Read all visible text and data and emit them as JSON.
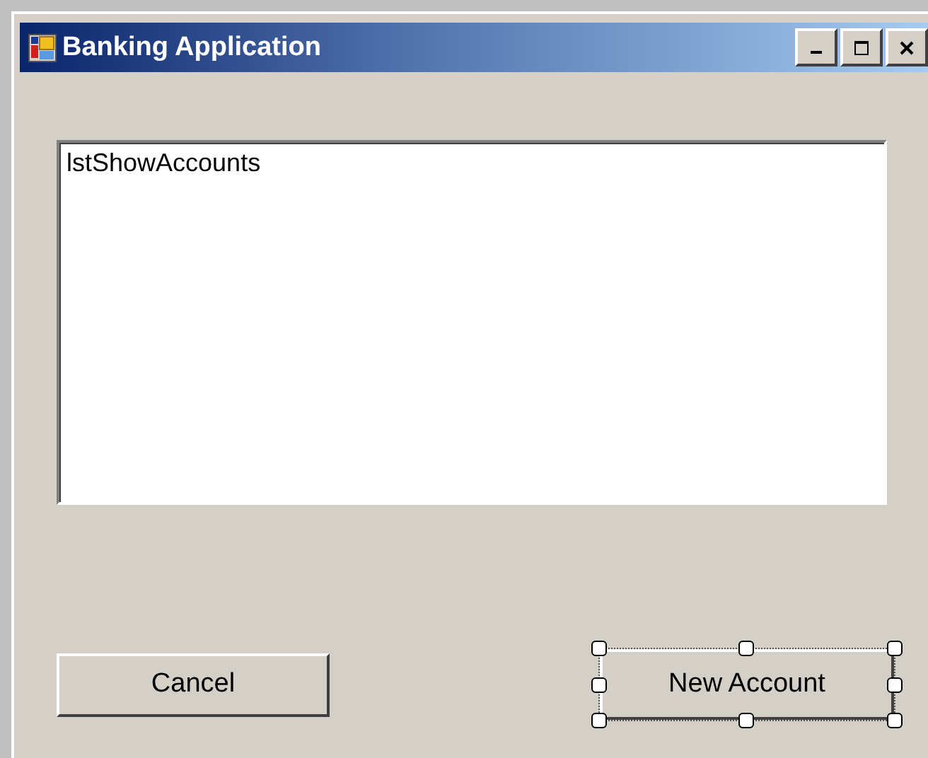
{
  "window": {
    "title": "Banking Application"
  },
  "listbox": {
    "items": [
      "lstShowAccounts"
    ]
  },
  "buttons": [
    {
      "label": "Cancel",
      "selected": false
    },
    {
      "label": "New Account",
      "selected": true
    }
  ]
}
